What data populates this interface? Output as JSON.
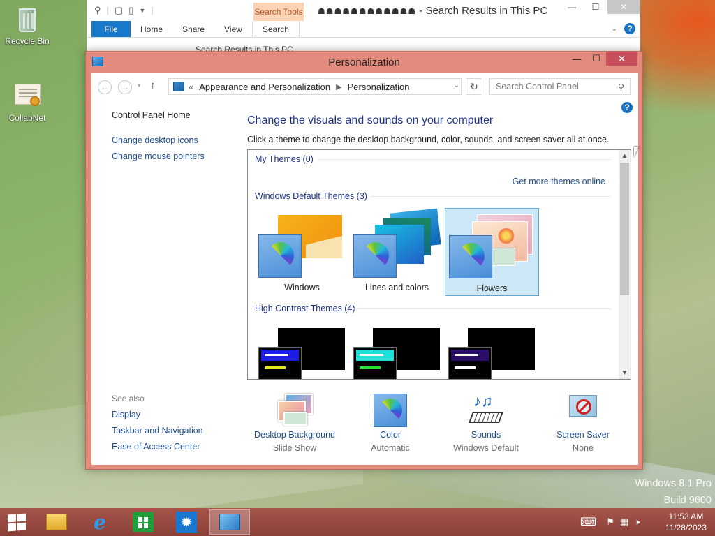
{
  "desktop": {
    "icons": [
      {
        "label": "Recycle Bin"
      },
      {
        "label": "CollabNet"
      }
    ],
    "watermark": {
      "line1": "Windows 8.1 Pro",
      "line2": "Build 9600"
    }
  },
  "bg_window": {
    "contextual_tab": "Search Tools",
    "title_glyphs": "☗☗☗☗☗☗☗☗☗☗☗☗",
    "title": "Search Results in This PC",
    "ribbon_tabs": [
      "File",
      "Home",
      "Share",
      "View",
      "Search"
    ],
    "address": "Search Results in This PC"
  },
  "window": {
    "title": "Personalization",
    "breadcrumb": [
      "Appearance and Personalization",
      "Personalization"
    ],
    "breadcrumb_prefix": "«",
    "search_placeholder": "Search Control Panel",
    "left_nav": {
      "home": "Control Panel Home",
      "links": [
        "Change desktop icons",
        "Change mouse pointers"
      ],
      "see_also_heading": "See also",
      "see_also": [
        "Display",
        "Taskbar and Navigation",
        "Ease of Access Center"
      ]
    },
    "heading": "Change the visuals and sounds on your computer",
    "subheading": "Click a theme to change the desktop background, color, sounds, and screen saver all at once.",
    "groups": {
      "my_themes": "My Themes (0)",
      "get_more": "Get more themes online",
      "default_themes": "Windows Default Themes (3)",
      "high_contrast": "High Contrast Themes (4)"
    },
    "themes": [
      {
        "name": "Windows",
        "selected": false
      },
      {
        "name": "Lines and colors",
        "selected": false
      },
      {
        "name": "Flowers",
        "selected": true
      }
    ],
    "high_contrast_colors": [
      "#1c1ce6",
      "#1ee0d8",
      "#2a0e6a"
    ],
    "bottom": [
      {
        "label": "Desktop Background",
        "value": "Slide Show"
      },
      {
        "label": "Color",
        "value": "Automatic"
      },
      {
        "label": "Sounds",
        "value": "Windows Default"
      },
      {
        "label": "Screen Saver",
        "value": "None"
      }
    ]
  },
  "taskbar": {
    "time": "11:53 AM",
    "date": "11/28/2023"
  },
  "colors": {
    "window_frame": "#e28a7c",
    "close_button": "#c7505c",
    "link": "#1e4e8a",
    "heading": "#1e3287",
    "selected_theme_bg": "#cce8f7"
  }
}
